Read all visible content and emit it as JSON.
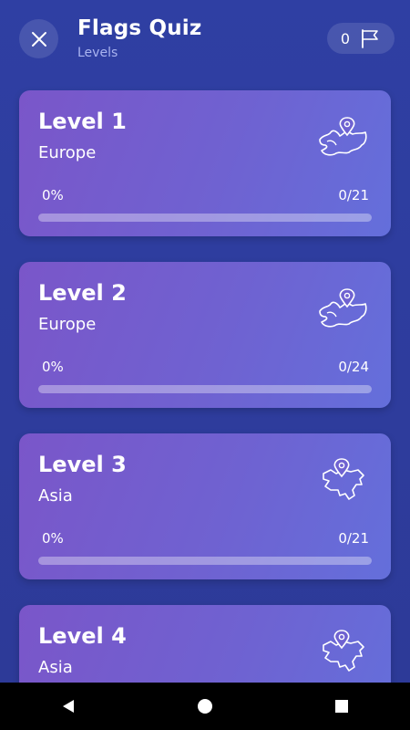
{
  "header": {
    "title": "Flags Quiz",
    "subtitle": "Levels",
    "close_icon": "close-icon",
    "score": "0",
    "score_icon": "flag-icon"
  },
  "levels": [
    {
      "title": "Level 1",
      "region": "Europe",
      "percent_label": "0%",
      "count": "0/21",
      "progress": 0,
      "icon": "europe-map-pin-icon"
    },
    {
      "title": "Level 2",
      "region": "Europe",
      "percent_label": "0%",
      "count": "0/24",
      "progress": 0,
      "icon": "europe-map-pin-icon"
    },
    {
      "title": "Level 3",
      "region": "Asia",
      "percent_label": "0%",
      "count": "0/21",
      "progress": 0,
      "icon": "asia-map-pin-icon"
    },
    {
      "title": "Level 4",
      "region": "Asia",
      "icon": "asia-map-pin-icon"
    }
  ],
  "navbar": {
    "back_icon": "back-triangle-icon",
    "home_icon": "home-circle-icon",
    "recents_icon": "recents-square-icon"
  },
  "colors": {
    "background": "#2f3fa3",
    "card_start": "#7a56c9",
    "card_end": "#646fdb",
    "subtitle": "#aab4f0"
  }
}
